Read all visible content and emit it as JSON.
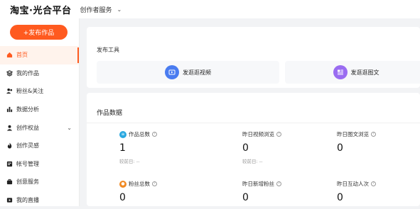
{
  "header": {
    "logo": "淘宝·光合平台",
    "service": "创作者服务"
  },
  "sidebar": {
    "publish_button": "+发布作品",
    "items": [
      {
        "label": "首页",
        "icon": "home-icon",
        "active": true
      },
      {
        "label": "我的作品",
        "icon": "layers-icon"
      },
      {
        "label": "粉丝&关注",
        "icon": "users-icon"
      },
      {
        "label": "数据分析",
        "icon": "bar-chart-icon"
      },
      {
        "label": "创作权益",
        "icon": "user-badge-icon",
        "has_caret": true
      },
      {
        "label": "创作灵感",
        "icon": "flame-icon"
      },
      {
        "label": "帐号管理",
        "icon": "id-card-icon"
      },
      {
        "label": "创意服务",
        "icon": "briefcase-icon"
      },
      {
        "label": "我的直播",
        "icon": "live-icon"
      }
    ]
  },
  "tools": {
    "section_title": "发布工具",
    "video_label": "发逛逛视频",
    "article_label": "发逛逛图文"
  },
  "works": {
    "title": "作品数据",
    "stats": [
      {
        "label": "作品总数",
        "value": "1",
        "sub": "较前日: --"
      },
      {
        "label": "昨日视频浏览",
        "value": "0",
        "sub": "较前日: --"
      },
      {
        "label": "昨日图文浏览",
        "value": "0",
        "sub": ""
      },
      {
        "label": "粉丝总数",
        "value": "0",
        "sub": ""
      },
      {
        "label": "昨日新增粉丝",
        "value": "0",
        "sub": ""
      },
      {
        "label": "昨日互动人次",
        "value": "0",
        "sub": ""
      }
    ]
  },
  "colors": {
    "accent": "#ff5a1f",
    "video_icon": "#4a7cf0",
    "article_icon": "#9a6cf1"
  }
}
